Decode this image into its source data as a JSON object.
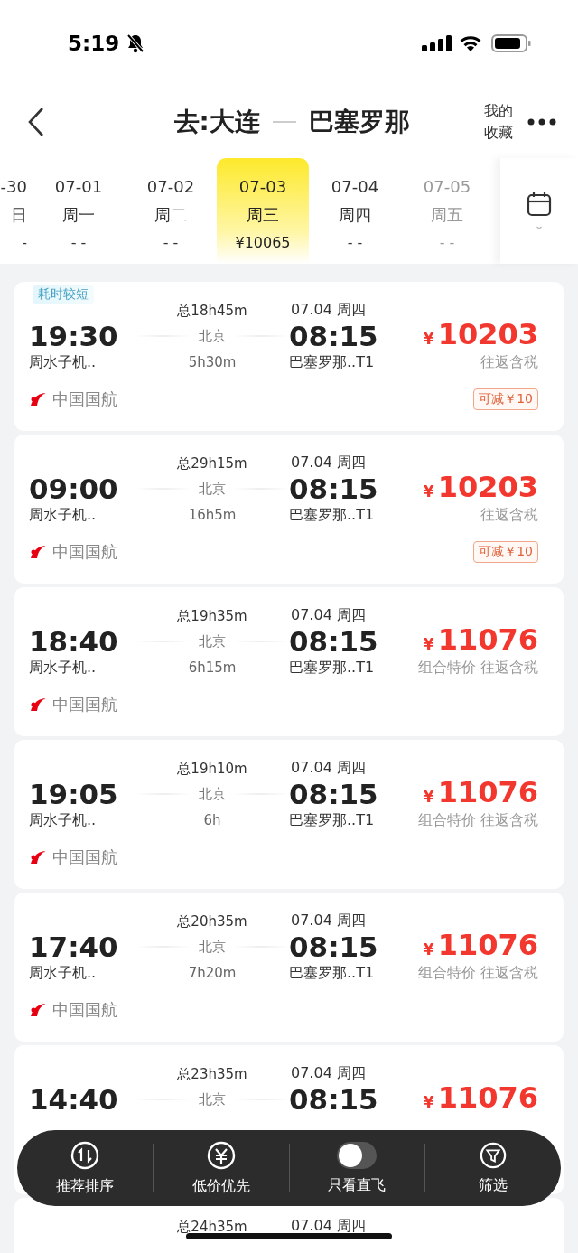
{
  "status_bar": {
    "time": "5:19"
  },
  "header": {
    "origin": "去:大连",
    "destination": "巴塞罗那",
    "favorites": "我的收藏"
  },
  "dates": [
    {
      "date": "-30",
      "weekday": "日",
      "price": "-",
      "selected": false
    },
    {
      "date": "07-01",
      "weekday": "周一",
      "price": "- -",
      "selected": false
    },
    {
      "date": "07-02",
      "weekday": "周二",
      "price": "- -",
      "selected": false
    },
    {
      "date": "07-03",
      "weekday": "周三",
      "price": "¥10065",
      "selected": true
    },
    {
      "date": "07-04",
      "weekday": "周四",
      "price": "- -",
      "selected": false
    },
    {
      "date": "07-05",
      "weekday": "周五",
      "price": "- -",
      "selected": false
    }
  ],
  "flights": [
    {
      "tag": "耗时较短",
      "departure_time": "19:30",
      "departure_airport": "周水子机..",
      "total": "总18h45m",
      "via": "北京",
      "layover": "5h30m",
      "arrival_date": "07.04 周四",
      "arrival_time": "08:15",
      "arrival_airport": "巴塞罗那..T1",
      "currency": "¥",
      "price": "10203",
      "price_notes": [
        "往返含税"
      ],
      "airline": "中国国航",
      "discount": "可减￥10"
    },
    {
      "departure_time": "09:00",
      "departure_airport": "周水子机..",
      "total": "总29h15m",
      "via": "北京",
      "layover": "16h5m",
      "arrival_date": "07.04 周四",
      "arrival_time": "08:15",
      "arrival_airport": "巴塞罗那..T1",
      "currency": "¥",
      "price": "10203",
      "price_notes": [
        "往返含税"
      ],
      "airline": "中国国航",
      "discount": "可减￥10"
    },
    {
      "departure_time": "18:40",
      "departure_airport": "周水子机..",
      "total": "总19h35m",
      "via": "北京",
      "layover": "6h15m",
      "arrival_date": "07.04 周四",
      "arrival_time": "08:15",
      "arrival_airport": "巴塞罗那..T1",
      "currency": "¥",
      "price": "11076",
      "price_notes": [
        "组合特价",
        "往返含税"
      ],
      "airline": "中国国航"
    },
    {
      "departure_time": "19:05",
      "departure_airport": "周水子机..",
      "total": "总19h10m",
      "via": "北京",
      "layover": "6h",
      "arrival_date": "07.04 周四",
      "arrival_time": "08:15",
      "arrival_airport": "巴塞罗那..T1",
      "currency": "¥",
      "price": "11076",
      "price_notes": [
        "组合特价",
        "往返含税"
      ],
      "airline": "中国国航"
    },
    {
      "departure_time": "17:40",
      "departure_airport": "周水子机..",
      "total": "总20h35m",
      "via": "北京",
      "layover": "7h20m",
      "arrival_date": "07.04 周四",
      "arrival_time": "08:15",
      "arrival_airport": "巴塞罗那..T1",
      "currency": "¥",
      "price": "11076",
      "price_notes": [
        "组合特价",
        "往返含税"
      ],
      "airline": "中国国航"
    },
    {
      "departure_time": "14:40",
      "total": "总23h35m",
      "via": "北京",
      "arrival_date": "07.04 周四",
      "arrival_time": "08:15",
      "currency": "¥",
      "price": "11076"
    },
    {
      "total": "总24h35m",
      "arrival_date": "07.04 周四"
    }
  ],
  "toolbar": [
    {
      "kind": "button",
      "label": "推荐排序"
    },
    {
      "kind": "button",
      "label": "低价优先"
    },
    {
      "kind": "toggle",
      "label": "只看直飞",
      "on": false
    },
    {
      "kind": "button",
      "label": "筛选"
    }
  ]
}
